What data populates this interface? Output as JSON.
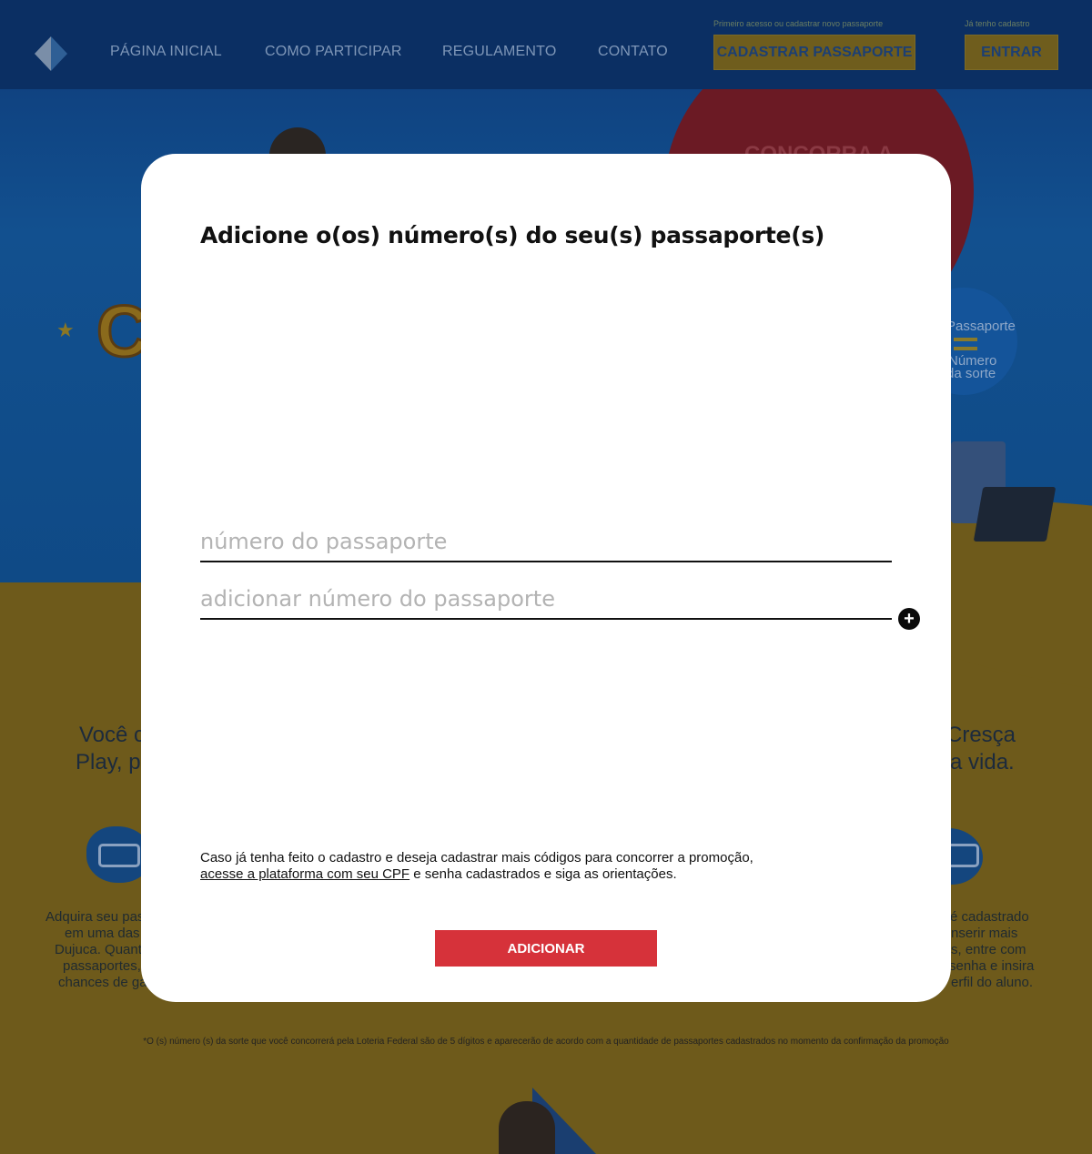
{
  "nav": {
    "items": [
      "PÁGINA INICIAL",
      "COMO PARTICIPAR",
      "REGULAMENTO",
      "CONTATO"
    ],
    "register_hint": "Primeiro acesso ou cadastrar novo passaporte",
    "register_button": "CADASTRAR PASSAPORTE",
    "login_hint": "Já tenho cadastro",
    "login_button": "ENTRAR"
  },
  "hero": {
    "circle_text": "CONCORRA A",
    "badge_line1": "Passaporte",
    "badge_line2": "Número",
    "badge_line3": "da sorte",
    "marquee_letter": "C"
  },
  "background": {
    "left_text_1": "Você c",
    "left_text_2": "Play, p",
    "right_text_1": "Cresça",
    "right_text_2": "a vida.",
    "left_small": [
      "Adquira seu pas",
      "em uma das",
      "Dujuca. Quant",
      "passaportes,",
      "chances de ga"
    ],
    "right_small": [
      "é cadastrado",
      "nserir mais",
      "s, entre com",
      "senha e insira",
      "erfil do aluno."
    ],
    "footnote": "*O (s) número (s) da sorte que você concorrerá pela Loteria Federal são de 5 dígitos e aparecerão de acordo com a quantidade de passaportes cadastrados no momento da confirmação da promoção"
  },
  "modal": {
    "title": "Adicione o(os) número(s) do seu(s) passaporte(s)",
    "field1_placeholder": "número do passaporte",
    "field2_placeholder": "adicionar número do passaporte",
    "plus_symbol": "+",
    "info_text_before": "Caso já tenha feito o cadastro e deseja cadastrar mais códigos para concorrer a promoção,",
    "info_link": "acesse a plataforma com seu CPF",
    "info_text_after": " e senha cadastrados e siga as orientações.",
    "add_button": "ADICIONAR"
  },
  "colors": {
    "modal_bg": "#ffffff",
    "add_button_bg": "#d6323a",
    "overlay_header": "#0b2f63"
  }
}
